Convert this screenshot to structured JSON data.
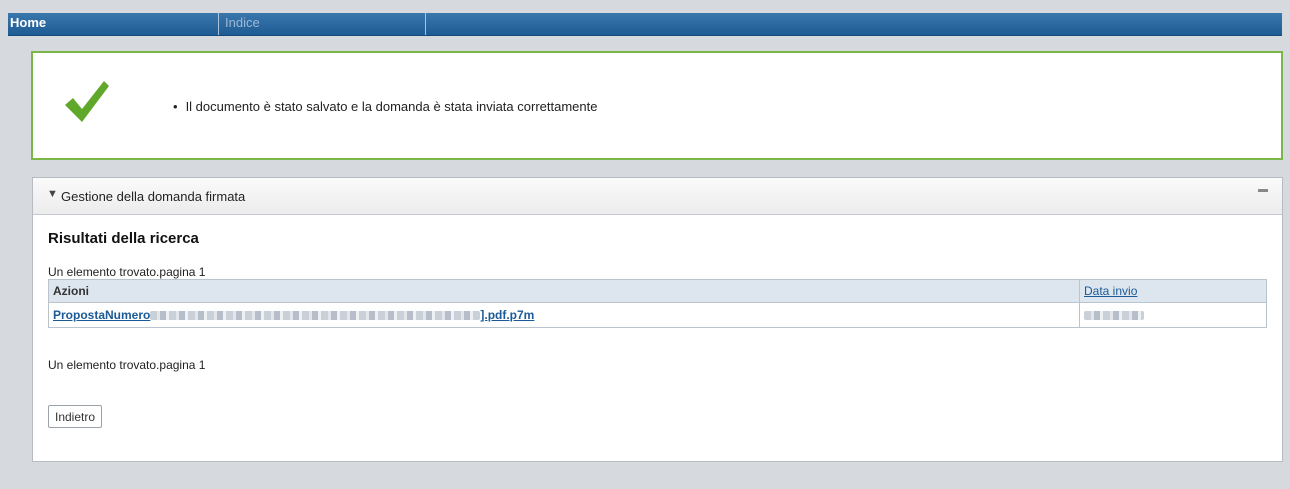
{
  "nav": {
    "home": "Home",
    "indice": "Indice"
  },
  "success": {
    "message": "Il documento è stato salvato e la domanda è stata inviata correttamente"
  },
  "panel": {
    "title": "Gestione della domanda firmata",
    "results_title": "Risultati della ricerca",
    "count_top": "Un elemento trovato.pagina 1",
    "count_bottom": "Un elemento trovato.pagina 1",
    "table": {
      "headers": [
        "Azioni",
        "Data invio"
      ],
      "rows": [
        {
          "link_prefix": "PropostaNumero",
          "link_suffix": "].pdf.p7m"
        }
      ]
    },
    "back_label": "Indietro"
  },
  "colors": {
    "nav_bar": "#1d5b93",
    "success_border": "#7ab648",
    "check": "#5fa82a",
    "link": "#1b5a96"
  }
}
